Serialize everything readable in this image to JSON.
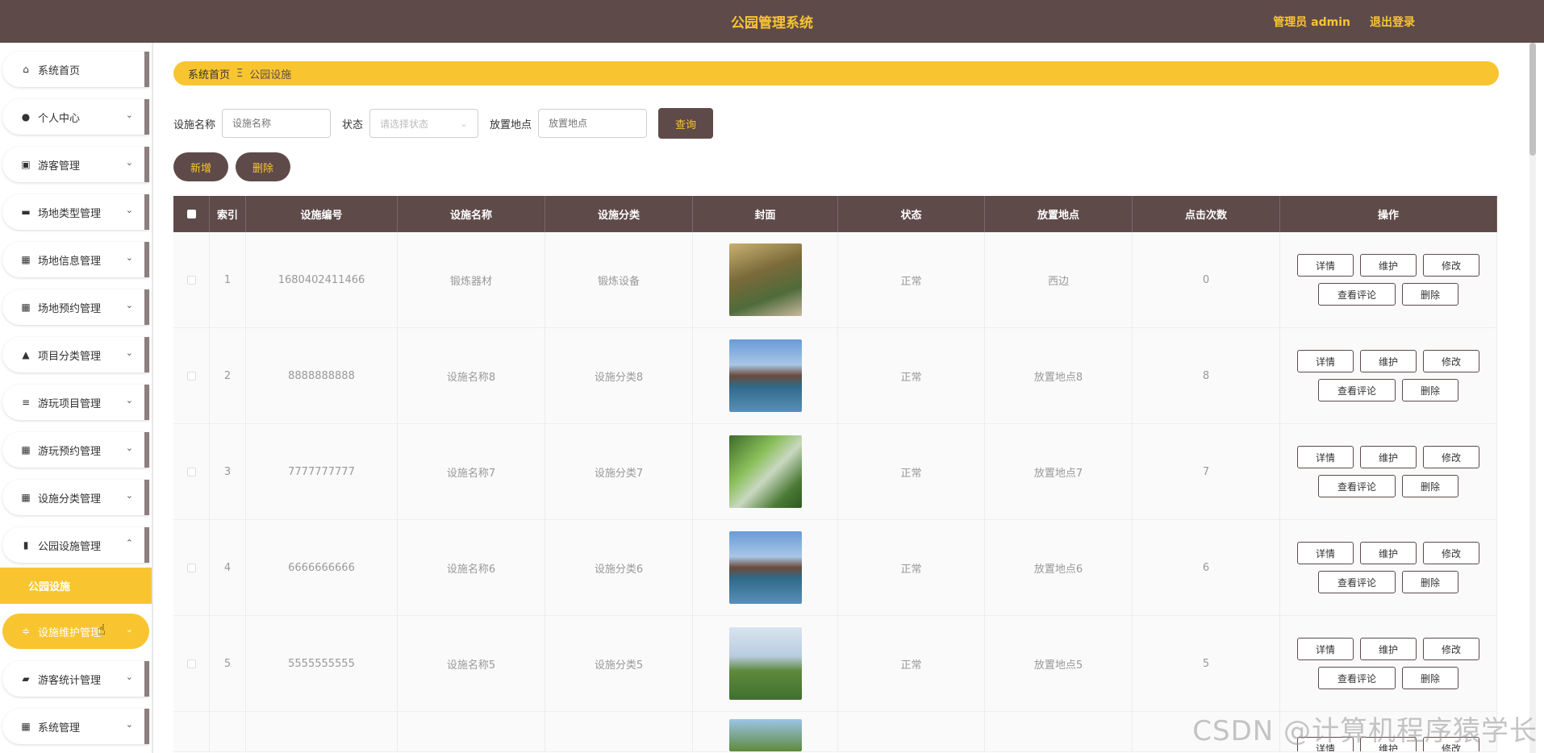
{
  "header": {
    "title": "公园管理系统",
    "admin": "管理员 admin",
    "logout": "退出登录"
  },
  "sidebar": {
    "items": [
      {
        "label": "系统首页",
        "icon": "home-icon",
        "glyph": "⌂",
        "chevron": ""
      },
      {
        "label": "个人中心",
        "icon": "user-icon",
        "glyph": "●",
        "chevron": "⌄"
      },
      {
        "label": "游客管理",
        "icon": "clipboard-icon",
        "glyph": "▣",
        "chevron": "⌄"
      },
      {
        "label": "场地类型管理",
        "icon": "monitor-icon",
        "glyph": "▬",
        "chevron": "⌄"
      },
      {
        "label": "场地信息管理",
        "icon": "grid-icon",
        "glyph": "▦",
        "chevron": "⌄"
      },
      {
        "label": "场地预约管理",
        "icon": "grid-icon",
        "glyph": "▦",
        "chevron": "⌄"
      },
      {
        "label": "项目分类管理",
        "icon": "person-icon",
        "glyph": "▲",
        "chevron": "⌄"
      },
      {
        "label": "游玩项目管理",
        "icon": "list-icon",
        "glyph": "≡",
        "chevron": "⌄"
      },
      {
        "label": "游玩预约管理",
        "icon": "grid-icon",
        "glyph": "▦",
        "chevron": "⌄"
      },
      {
        "label": "设施分类管理",
        "icon": "grid-icon",
        "glyph": "▦",
        "chevron": "⌄"
      },
      {
        "label": "公园设施管理",
        "icon": "bar-chart-icon",
        "glyph": "▮",
        "chevron": "⌃"
      },
      {
        "label": "设施维护管理",
        "icon": "sliders-icon",
        "glyph": "≑",
        "chevron": "⌄"
      },
      {
        "label": "游客统计管理",
        "icon": "briefcase-icon",
        "glyph": "▰",
        "chevron": "⌄"
      },
      {
        "label": "系统管理",
        "icon": "grid-icon",
        "glyph": "▦",
        "chevron": "⌄"
      }
    ],
    "submenu": {
      "label": "公园设施"
    }
  },
  "breadcrumb": {
    "home": "系统首页",
    "sep": "Ξ",
    "current": "公园设施"
  },
  "search": {
    "name_label": "设施名称",
    "name_placeholder": "设施名称",
    "status_label": "状态",
    "status_placeholder": "请选择状态",
    "location_label": "放置地点",
    "location_placeholder": "放置地点",
    "query": "查询"
  },
  "actions": {
    "add": "新增",
    "delete": "删除"
  },
  "table": {
    "headers": [
      "索引",
      "设施编号",
      "设施名称",
      "设施分类",
      "封面",
      "状态",
      "放置地点",
      "点击次数",
      "操作"
    ],
    "rows": [
      {
        "idx": "1",
        "no": "1680402411466",
        "name": "锻炼器材",
        "cat": "锻炼设备",
        "status": "正常",
        "loc": "西边",
        "clicks": "0"
      },
      {
        "idx": "2",
        "no": "8888888888",
        "name": "设施名称8",
        "cat": "设施分类8",
        "status": "正常",
        "loc": "放置地点8",
        "clicks": "8"
      },
      {
        "idx": "3",
        "no": "7777777777",
        "name": "设施名称7",
        "cat": "设施分类7",
        "status": "正常",
        "loc": "放置地点7",
        "clicks": "7"
      },
      {
        "idx": "4",
        "no": "6666666666",
        "name": "设施名称6",
        "cat": "设施分类6",
        "status": "正常",
        "loc": "放置地点6",
        "clicks": "6"
      },
      {
        "idx": "5",
        "no": "5555555555",
        "name": "设施名称5",
        "cat": "设施分类5",
        "status": "正常",
        "loc": "放置地点5",
        "clicks": "5"
      }
    ],
    "ops": {
      "detail": "详情",
      "maintain": "维护",
      "edit": "修改",
      "comments": "查看评论",
      "delete": "删除"
    }
  },
  "watermark": "CSDN @计算机程序猿学长",
  "colors": {
    "header": "#5f4a4a",
    "accent": "#f8c531"
  }
}
